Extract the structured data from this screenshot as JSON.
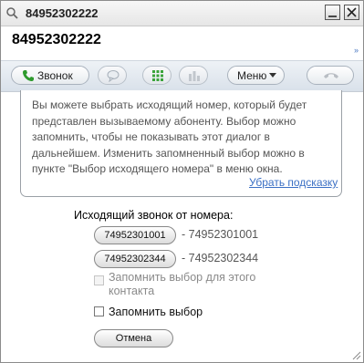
{
  "window": {
    "title": "84952302222",
    "min_label": "_",
    "close_label": "X"
  },
  "contact": {
    "name": "84952302222",
    "expand_glyph": "»"
  },
  "toolbar": {
    "call_label": "Звонок",
    "menu_label": "Меню",
    "icons": [
      "chat-bubble-icon",
      "dialpad-icon",
      "bars-icon",
      "hangup-icon"
    ],
    "accent": "#2e9b2e"
  },
  "hint": {
    "text": "Вы можете выбрать исходящий номер, который будет\nпредставлен вызываемому абоненту. Выбор можно\nзапомнить, чтобы не показывать этот диалог в\nдальнейшем. Изменить запомненный выбор можно в\nпункте \"Выбор исходящего номера\" в меню окна.",
    "hide_link": "Убрать подсказку"
  },
  "outgoing": {
    "title": "Исходящий звонок от номера:",
    "options": [
      {
        "button": "74952301001",
        "label": "- 74952301001"
      },
      {
        "button": "74952302344",
        "label": "- 74952302344"
      }
    ],
    "remember_contact": "Запомнить выбор для этого\nконтакта",
    "remember_contact_checked": false,
    "remember_contact_enabled": false,
    "remember": "Запомнить выбор",
    "remember_checked": false,
    "cancel": "Отмена"
  }
}
